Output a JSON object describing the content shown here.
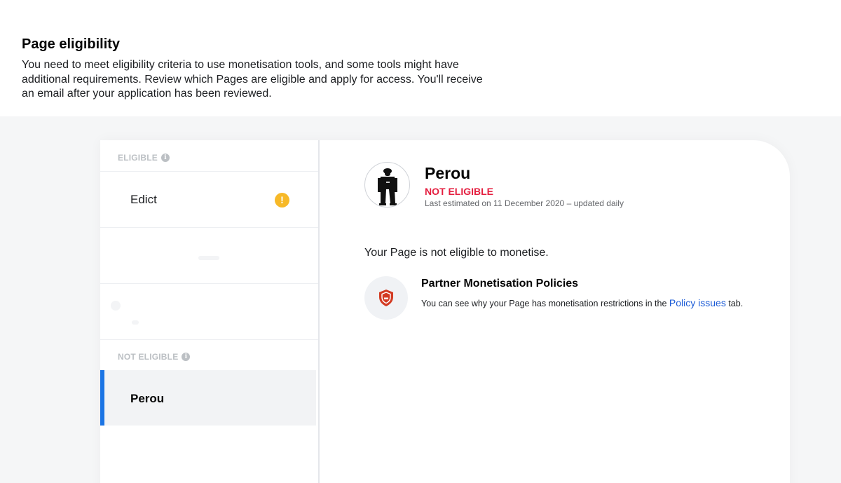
{
  "header": {
    "title": "Page eligibility",
    "description": "You need to meet eligibility criteria to use monetisation tools, and some tools might have additional requirements. Review which Pages are eligible and apply for access. You'll receive an email after your application has been reviewed."
  },
  "sidebar": {
    "eligible_label": "ELIGIBLE",
    "not_eligible_label": "NOT ELIGIBLE",
    "eligible_items": [
      {
        "name": "Edict",
        "icon": "warning-icon"
      }
    ],
    "not_eligible_items": [
      {
        "name": "Perou",
        "selected": true
      }
    ]
  },
  "detail": {
    "page_name": "Perou",
    "status": "NOT ELIGIBLE",
    "estimate": "Last estimated on 11 December 2020 – updated daily",
    "message": "Your Page is not eligible to monetise.",
    "policy": {
      "title": "Partner Monetisation Policies",
      "text_before": "You can see why your Page has monetisation restrictions in the",
      "link": "Policy issues",
      "text_after": "tab."
    }
  },
  "colors": {
    "accent": "#1b74e4",
    "status_red": "#e41e3f",
    "warning": "#f7b928",
    "link": "#1b5bd6"
  }
}
